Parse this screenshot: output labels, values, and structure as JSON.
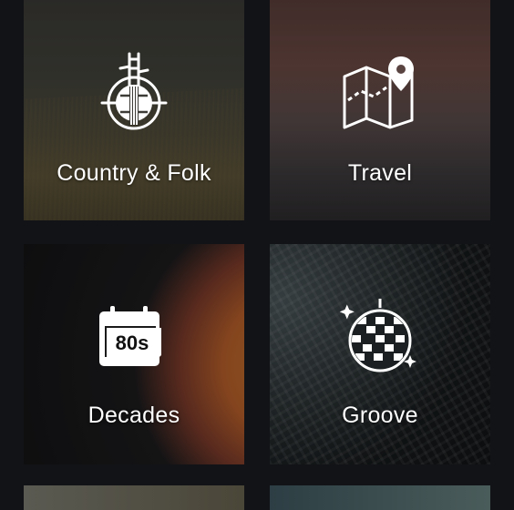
{
  "tiles": [
    {
      "label": "Country & Folk",
      "icon": "banjo-icon"
    },
    {
      "label": "Travel",
      "icon": "map-pin-icon"
    },
    {
      "label": "Decades",
      "icon": "calendar-80s-icon",
      "icon_text": "80s"
    },
    {
      "label": "Groove",
      "icon": "disco-ball-icon"
    }
  ]
}
